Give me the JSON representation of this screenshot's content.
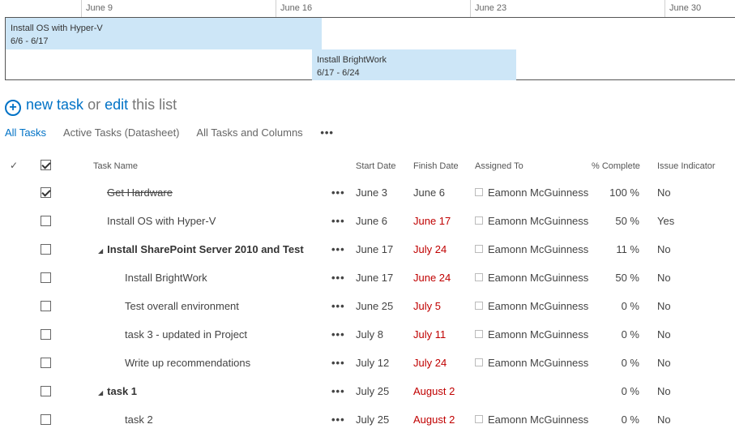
{
  "timeline": {
    "dates": [
      "June 9",
      "June 16",
      "June 23",
      "June 30"
    ],
    "bars": [
      {
        "title": "Install OS with Hyper-V",
        "range": "6/6 - 6/17"
      },
      {
        "title": "Install BrightWork",
        "range": "6/17 - 6/24"
      }
    ]
  },
  "new_task": {
    "new_task": "new task",
    "or": "or",
    "edit": "edit",
    "this_list": "this list"
  },
  "views": {
    "all_tasks": "All Tasks",
    "active_tasks": "Active Tasks (Datasheet)",
    "all_tasks_columns": "All Tasks and Columns",
    "more": "•••"
  },
  "table": {
    "headers": {
      "check": "✓",
      "task_name": "Task Name",
      "start_date": "Start Date",
      "finish_date": "Finish Date",
      "assigned_to": "Assigned To",
      "percent_complete": "% Complete",
      "issue_indicator": "Issue Indicator"
    },
    "rows": [
      {
        "name": "Get Hardware",
        "start": "June 3",
        "finish": "June 6",
        "assigned": "Eamonn McGuinness",
        "complete": "100 %",
        "issue": "No",
        "checked": true,
        "late": false,
        "summary": false,
        "indent": 1
      },
      {
        "name": "Install OS with Hyper-V",
        "start": "June 6",
        "finish": "June 17",
        "assigned": "Eamonn McGuinness",
        "complete": "50 %",
        "issue": "Yes",
        "checked": false,
        "late": true,
        "summary": false,
        "indent": 1
      },
      {
        "name": "Install SharePoint Server 2010 and Test",
        "start": "June 17",
        "finish": "July 24",
        "assigned": "Eamonn McGuinness",
        "complete": "11 %",
        "issue": "No",
        "checked": false,
        "late": true,
        "summary": true,
        "indent": 0
      },
      {
        "name": "Install BrightWork",
        "start": "June 17",
        "finish": "June 24",
        "assigned": "Eamonn McGuinness",
        "complete": "50 %",
        "issue": "No",
        "checked": false,
        "late": true,
        "summary": false,
        "indent": 2
      },
      {
        "name": "Test overall environment",
        "start": "June 25",
        "finish": "July 5",
        "assigned": "Eamonn McGuinness",
        "complete": "0 %",
        "issue": "No",
        "checked": false,
        "late": true,
        "summary": false,
        "indent": 2
      },
      {
        "name": "task 3 - updated in Project",
        "start": "July 8",
        "finish": "July 11",
        "assigned": "Eamonn McGuinness",
        "complete": "0 %",
        "issue": "No",
        "checked": false,
        "late": true,
        "summary": false,
        "indent": 2
      },
      {
        "name": "Write up recommendations",
        "start": "July 12",
        "finish": "July 24",
        "assigned": "Eamonn McGuinness",
        "complete": "0 %",
        "issue": "No",
        "checked": false,
        "late": true,
        "summary": false,
        "indent": 2
      },
      {
        "name": "task 1",
        "start": "July 25",
        "finish": "August 2",
        "assigned": "",
        "complete": "0 %",
        "issue": "No",
        "checked": false,
        "late": true,
        "summary": true,
        "indent": 0
      },
      {
        "name": "task 2",
        "start": "July 25",
        "finish": "August 2",
        "assigned": "Eamonn McGuinness",
        "complete": "0 %",
        "issue": "No",
        "checked": false,
        "late": true,
        "summary": false,
        "indent": 2
      }
    ],
    "row_menu": "•••"
  },
  "colors": {
    "accent": "#0072c6",
    "late": "#c00000",
    "bar": "#cde6f7"
  }
}
